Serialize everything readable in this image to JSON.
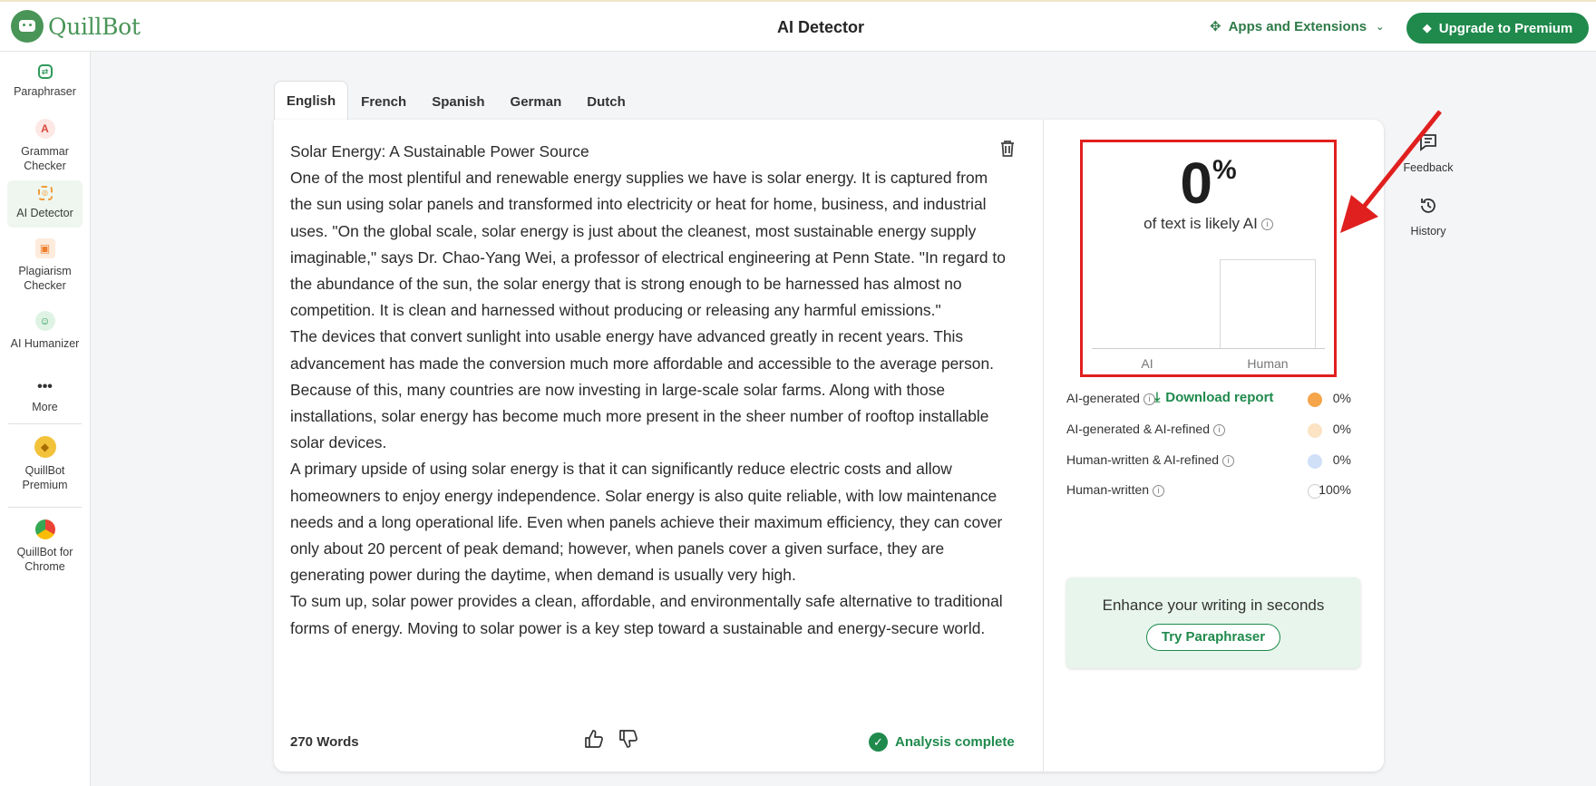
{
  "header": {
    "brand": "QuillBot",
    "title": "AI Detector",
    "apps_label": "Apps and Extensions",
    "upgrade_label": "Upgrade to Premium"
  },
  "sidebar": {
    "items": [
      {
        "label": "Paraphraser"
      },
      {
        "label": "Grammar Checker"
      },
      {
        "label": "AI Detector"
      },
      {
        "label": "Plagiarism Checker"
      },
      {
        "label": "AI Humanizer"
      },
      {
        "label": "More"
      },
      {
        "label": "QuillBot Premium"
      },
      {
        "label": "QuillBot for Chrome"
      }
    ]
  },
  "tabs": [
    "English",
    "French",
    "Spanish",
    "German",
    "Dutch"
  ],
  "editor": {
    "title_line": "Solar Energy: A Sustainable Power Source",
    "paragraphs": [
      "One of the most plentiful and renewable energy supplies we have is solar energy. It is captured from the sun using solar panels and transformed into electricity or heat for home, business, and industrial uses. \"On the global scale, solar energy is just about the cleanest, most sustainable energy supply imaginable,\" says Dr. Chao-Yang Wei, a professor of electrical engineering at Penn State. \"In regard to the abundance of the sun, the solar energy that is strong enough to be harnessed has almost no competition. It is clean and harnessed without producing or releasing any harmful emissions.\"",
      "The devices that convert sunlight into usable energy have advanced greatly in recent years. This advancement has made the conversion much more affordable and accessible to the average person. Because of this, many countries are now investing in large-scale solar farms. Along with those installations, solar energy has become much more present in the sheer number of rooftop installable solar devices.",
      "A primary upside of using solar energy is that it can significantly reduce electric costs and allow homeowners to enjoy energy independence. Solar energy is also quite reliable, with low maintenance needs and a long operational life. Even when panels achieve their maximum efficiency, they can cover only about 20 percent of peak demand; however, when panels cover a given surface, they are generating power during the daytime, when demand is usually very high.",
      "To sum up, solar power provides a clean, affordable, and environmentally safe alternative to traditional forms of energy. Moving to solar power is a key step toward a sustainable and energy-secure world."
    ],
    "word_count": "270 Words",
    "status": "Analysis complete"
  },
  "results": {
    "score_value": "0",
    "score_unit": "%",
    "score_caption": "of text is likely AI",
    "chart": {
      "categories": [
        "AI",
        "Human"
      ],
      "values": [
        0,
        100
      ]
    },
    "download_label": "Download report",
    "legend": [
      {
        "label": "AI-generated",
        "pct": "0%",
        "color": "#f5a54a"
      },
      {
        "label": "AI-generated & AI-refined",
        "pct": "0%",
        "color": "#fbe3c3"
      },
      {
        "label": "Human-written & AI-refined",
        "pct": "0%",
        "color": "#cfe0f7"
      },
      {
        "label": "Human-written",
        "pct": "100%",
        "color": "#ffffff"
      }
    ],
    "promo_title": "Enhance your writing in seconds",
    "promo_button": "Try Paraphraser"
  },
  "tools": [
    {
      "label": "Feedback",
      "icon": "feedback-icon"
    },
    {
      "label": "History",
      "icon": "history-icon"
    }
  ]
}
